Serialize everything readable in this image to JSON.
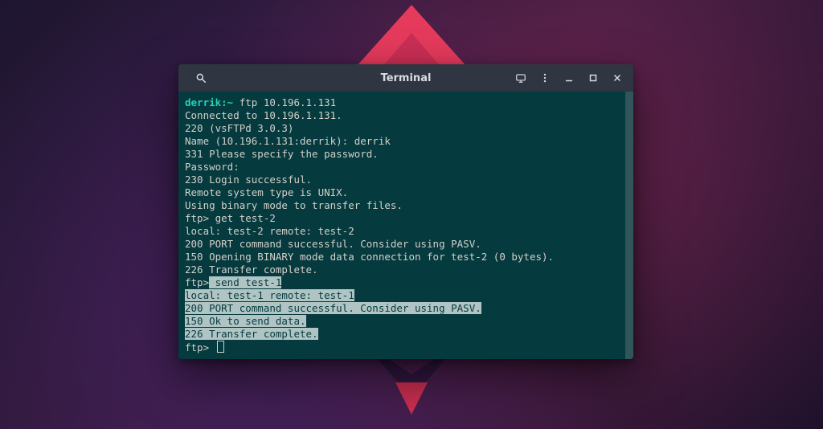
{
  "titlebar": {
    "title": "Terminal"
  },
  "term": {
    "shell_prompt_user": "derrik:~",
    "shell_prompt_cmd": " ftp 10.196.1.131",
    "lines": [
      "Connected to 10.196.1.131.",
      "220 (vsFTPd 3.0.3)",
      "Name (10.196.1.131:derrik): derrik",
      "331 Please specify the password.",
      "Password:",
      "230 Login successful.",
      "Remote system type is UNIX.",
      "Using binary mode to transfer files.",
      "ftp> get test-2",
      "local: test-2 remote: test-2",
      "200 PORT command successful. Consider using PASV.",
      "150 Opening BINARY mode data connection for test-2 (0 bytes).",
      "226 Transfer complete."
    ],
    "sel_prefix": "ftp>",
    "sel_lines": [
      " send test-1",
      "local: test-1 remote: test-1",
      "200 PORT command successful. Consider using PASV.",
      "150 Ok to send data.",
      "226 Transfer complete."
    ],
    "final_prompt": "ftp> "
  }
}
